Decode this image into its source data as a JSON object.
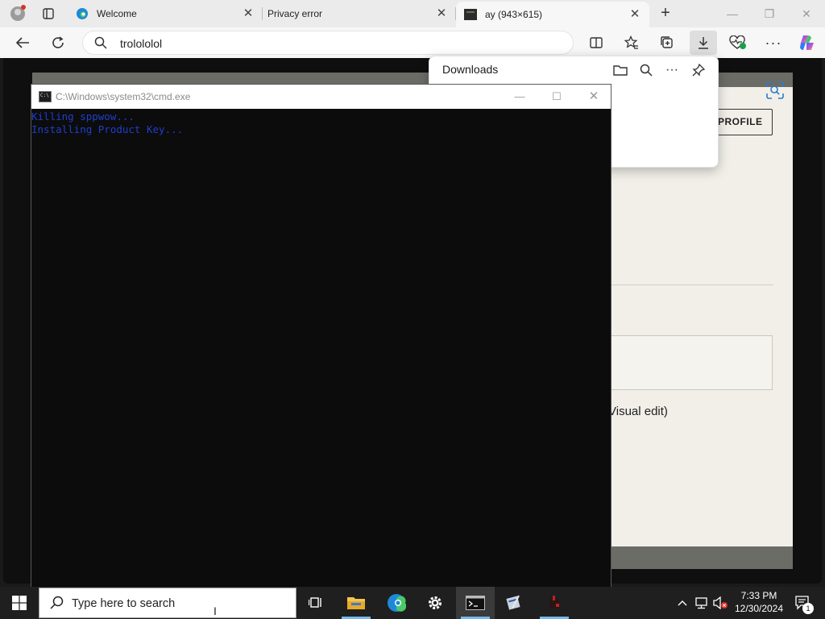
{
  "browser": {
    "tabs": [
      {
        "label": "Welcome"
      },
      {
        "label": "Privacy error"
      },
      {
        "label": "ay (943×615)"
      }
    ],
    "address": {
      "value": "trolololol"
    }
  },
  "downloads": {
    "title": "Downloads"
  },
  "page": {
    "profile_button": "PROFILE",
    "visual_edit_text": "Visual edit)"
  },
  "cmd": {
    "title": "C:\\Windows\\system32\\cmd.exe",
    "lines": [
      "Killing sppwow...",
      "Installing Product Key..."
    ]
  },
  "taskbar": {
    "search_placeholder": "Type here to search",
    "time": "7:33 PM",
    "date": "12/30/2024",
    "notification_count": "1"
  },
  "colors": {
    "console_text": "#1e3fcc",
    "page_bg": "#f1efe8",
    "taskbar_bg": "#1f1f1f",
    "accent": "#76b9ed"
  }
}
